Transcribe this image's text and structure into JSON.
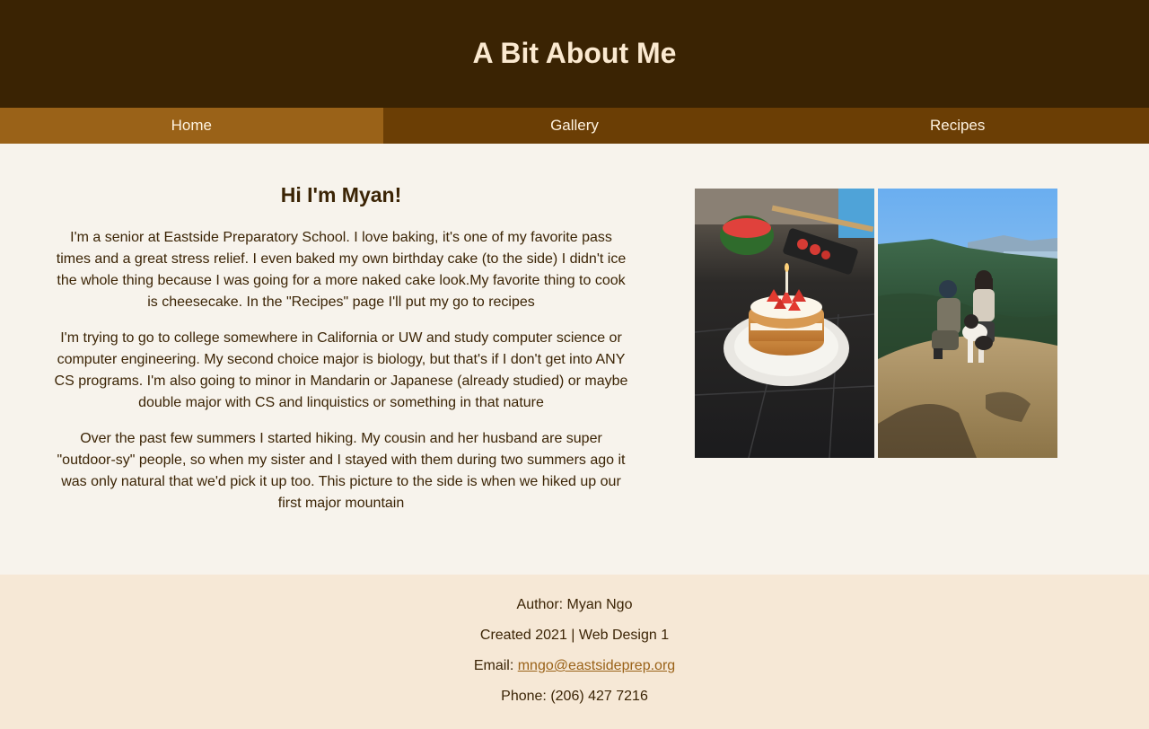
{
  "header": {
    "title": "A Bit About Me"
  },
  "nav": {
    "items": [
      {
        "label": "Home",
        "active": true
      },
      {
        "label": "Gallery",
        "active": false
      },
      {
        "label": "Recipes",
        "active": false
      }
    ]
  },
  "main": {
    "heading": "Hi I'm Myan!",
    "paragraphs": [
      "I'm a senior at Eastside Preparatory School. I love baking, it's one of my favorite pass times and a great stress relief. I even baked my own birthday cake (to the side) I didn't ice the whole thing because I was going for a more naked cake look.My favorite thing to cook is cheesecake. In the \"Recipes\" page I'll put my go to recipes",
      "I'm trying to go to college somewhere in California or UW and study computer science or computer engineering. My second choice major is biology, but that's if I don't get into ANY CS programs. I'm also going to minor in Mandarin or Japanese (already studied) or maybe double major with CS and linquistics or something in that nature",
      "Over the past few summers I started hiking. My cousin and her husband are super \"outdoor-sy\" people, so when my sister and I stayed with them during two summers ago it was only natural that we'd pick it up too. This picture to the side is when we hiked up our first major mountain"
    ],
    "photos": [
      {
        "subject": "birthday-cake-photo"
      },
      {
        "subject": "hiking-mountain-photo"
      }
    ]
  },
  "footer": {
    "author": "Author: Myan Ngo",
    "created": "Created 2021 | Web Design 1",
    "email_prefix": "Email: ",
    "email": "mngo@eastsideprep.org",
    "phone": "Phone: (206) 427 7216"
  },
  "colors": {
    "header_bg": "#3a2303",
    "nav_bg": "#6b3e05",
    "nav_active": "#9a6218",
    "page_bg": "#f7f3ec",
    "footer_bg": "#f6e8d6",
    "text": "#3b2405"
  }
}
